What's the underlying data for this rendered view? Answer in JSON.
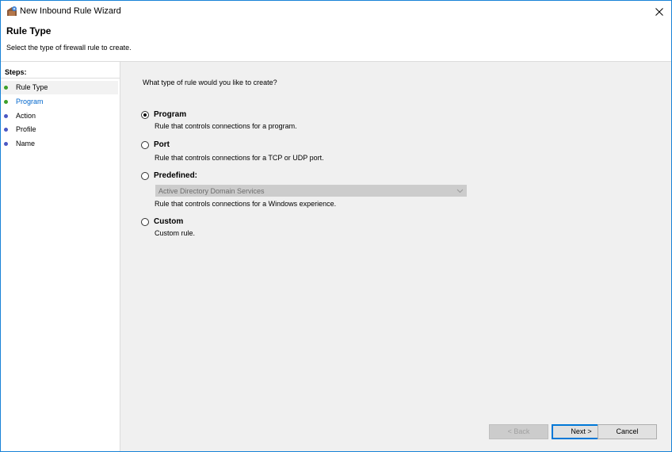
{
  "window": {
    "title": "New Inbound Rule Wizard",
    "icon": "firewall-rule-icon"
  },
  "header": {
    "title": "Rule Type",
    "subtitle": "Select the type of firewall rule to create."
  },
  "steps": {
    "heading": "Steps:",
    "items": [
      {
        "label": "Rule Type",
        "state": "current",
        "dot_color": "#3c9f2a"
      },
      {
        "label": "Program",
        "state": "link",
        "dot_color": "#3c9f2a"
      },
      {
        "label": "Action",
        "state": "pending",
        "dot_color": "#4b58c4"
      },
      {
        "label": "Profile",
        "state": "pending",
        "dot_color": "#4b58c4"
      },
      {
        "label": "Name",
        "state": "pending",
        "dot_color": "#4b58c4"
      }
    ]
  },
  "content": {
    "question": "What type of rule would you like to create?",
    "options": [
      {
        "label": "Program",
        "description": "Rule that controls connections for a program.",
        "checked": true
      },
      {
        "label": "Port",
        "description": "Rule that controls connections for a TCP or UDP port.",
        "checked": false
      },
      {
        "label": "Predefined:",
        "description": "Rule that controls connections for a Windows experience.",
        "checked": false
      },
      {
        "label": "Custom",
        "description": "Custom rule.",
        "checked": false
      }
    ],
    "predefined_select": {
      "value": "Active Directory Domain Services",
      "enabled": false
    }
  },
  "buttons": {
    "back": "< Back",
    "next": "Next >",
    "cancel": "Cancel"
  },
  "colors": {
    "window_border": "#1883d7",
    "link_blue": "#0066cc",
    "done_dot": "#3c9f2a",
    "pending_dot": "#4b58c4",
    "default_button_border": "#0078d7"
  }
}
